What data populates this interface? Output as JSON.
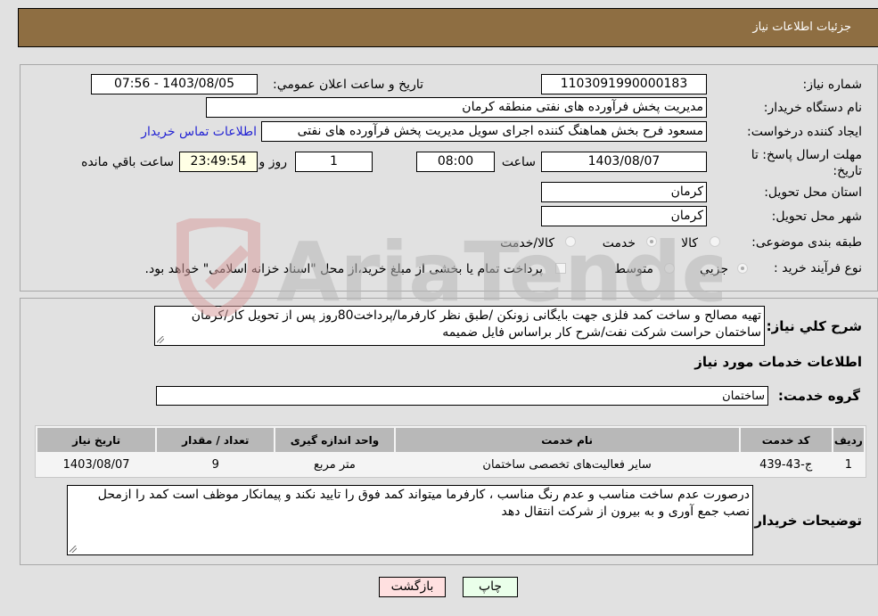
{
  "header": {
    "title": "جزئیات اطلاعات نیاز"
  },
  "form": {
    "need_number": {
      "label": "شماره نیاز:",
      "value": "1103091990000183"
    },
    "announce_datetime": {
      "label": "تاریخ و ساعت اعلان عمومي:",
      "value": "1403/08/05 - 07:56"
    },
    "buyer_org": {
      "label": "نام دستگاه خریدار:",
      "value": "مدیریت پخش فرآورده های نفتی منطقه کرمان"
    },
    "requester": {
      "label": "ایجاد کننده درخواست:",
      "value": "مسعود فرح بخش هماهنگ کننده اجرای سویل مدیریت پخش فرآورده های نفتی"
    },
    "buyer_contact_link": "اطلاعات تماس خریدار",
    "deadline": {
      "label": "مهلت ارسال پاسخ: تا تاریخ:",
      "date": "1403/08/07",
      "time_label": "ساعت",
      "time": "08:00",
      "days": "1",
      "days_label": "روز و",
      "remaining": "23:49:54",
      "remaining_label": "ساعت باقي مانده"
    },
    "province": {
      "label": "استان محل تحویل:",
      "value": "کرمان"
    },
    "city": {
      "label": "شهر محل تحویل:",
      "value": "کرمان"
    },
    "category": {
      "label": "طبقه بندی موضوعی:",
      "options": [
        "کالا",
        "خدمت",
        "کالا/خدمت"
      ],
      "selected": "خدمت"
    },
    "purchase_type": {
      "label": "نوع فرآیند خرید :",
      "options": [
        "جزيي",
        "متوسط"
      ],
      "selected": "جزيي",
      "treasury_note": "پرداخت تمام یا بخشی از مبلغ خرید،از محل \"اسناد خزانه اسلامی\" خواهد بود.",
      "treasury_checked": false
    }
  },
  "description": {
    "label": "شرح کلي نیاز:",
    "value": "تهیه مصالح و ساخت کمد فلزی جهت بایگانی زونکن /طبق نظر کارفرما/پرداخت80روز پس از تحویل کار/کرمان ساختمان حراست شرکت نفت/شرح کار براساس فایل ضمیمه"
  },
  "services": {
    "section_title": "اطلاعات خدمات مورد نیاز",
    "group_label": "گروه خدمت:",
    "group_value": "ساختمان",
    "table": {
      "headers": [
        "ردیف",
        "کد خدمت",
        "نام خدمت",
        "واحد اندازه گیری",
        "تعداد / مقدار",
        "تاریخ نیاز"
      ],
      "rows": [
        [
          "1",
          "ج-43-439",
          "سایر فعالیت‌های تخصصی ساختمان",
          "متر مربع",
          "9",
          "1403/08/07"
        ]
      ]
    }
  },
  "buyer_notes": {
    "label": "توضیحات خریدار:",
    "value": "درصورت عدم ساخت مناسب و عدم رنگ مناسب ، کارفرما میتواند کمد فوق را تایید نکند و پیمانکار موظف است کمد را ازمحل نصب جمع آوری و به بیرون از شرکت انتقال دهد"
  },
  "buttons": {
    "print": "چاپ",
    "back": "بازگشت"
  },
  "watermark": {
    "text": "AriaTender.neT"
  },
  "colors": {
    "header_bg": "#8e6e42",
    "print_bg": "#eaffea",
    "back_bg": "#ffe0e0",
    "link": "#2424d4"
  }
}
